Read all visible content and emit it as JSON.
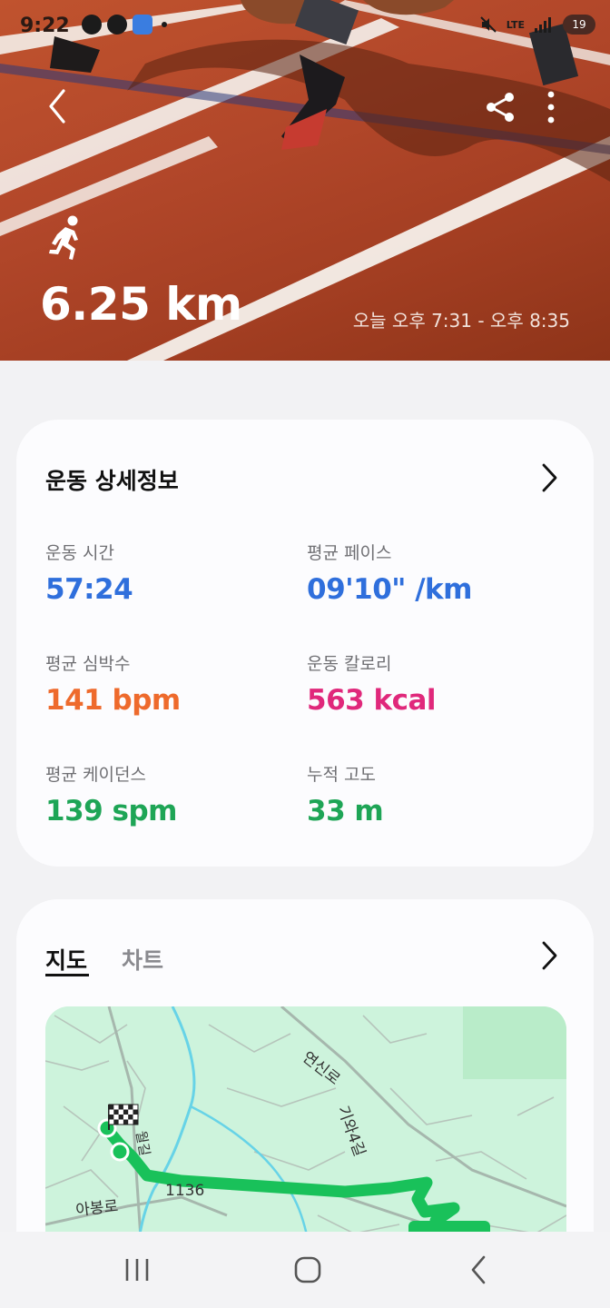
{
  "status_bar": {
    "time": "9:22",
    "network": "LTE",
    "battery": "19"
  },
  "hero": {
    "distance": "6.25 km",
    "time_range": "오늘 오후 7:31 - 오후 8:35",
    "icons": [
      "back-icon",
      "share-icon",
      "more-vert-icon",
      "running-icon"
    ]
  },
  "details": {
    "title": "운동 상세정보",
    "stats": [
      {
        "label": "운동 시간",
        "value": "57:24",
        "color": "#2f6fdc"
      },
      {
        "label": "평균 페이스",
        "value": "09'10\" /km",
        "color": "#2f6fdc"
      },
      {
        "label": "평균 심박수",
        "value": "141 bpm",
        "color": "#ee6a2c"
      },
      {
        "label": "운동 칼로리",
        "value": "563 kcal",
        "color": "#e0287b"
      },
      {
        "label": "평균 케이던스",
        "value": "139 spm",
        "color": "#1ea556"
      },
      {
        "label": "누적 고도",
        "value": "33 m",
        "color": "#1ea556"
      }
    ]
  },
  "map_card": {
    "tabs": [
      "지도",
      "차트"
    ],
    "active_tab": "지도",
    "map_labels": {
      "road_1": "연신로",
      "road_2": "기와4길",
      "road_3": "1136",
      "road_4": "아봉로",
      "road_5": "월길"
    },
    "route_color": "#19c15a"
  },
  "nav_bar": {
    "icons": [
      "recents-icon",
      "home-icon",
      "back-icon"
    ]
  }
}
